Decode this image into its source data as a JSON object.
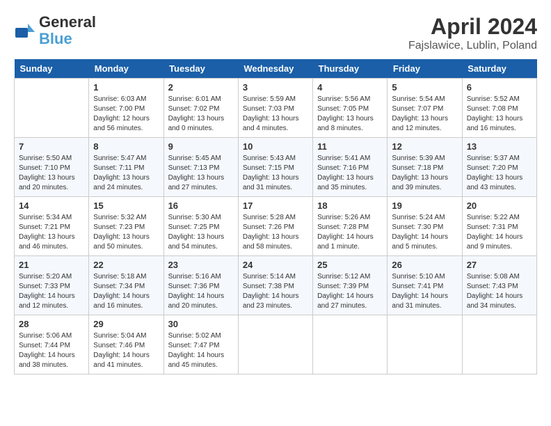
{
  "header": {
    "logo_line1": "General",
    "logo_line2": "Blue",
    "title": "April 2024",
    "location": "Fajslawice, Lublin, Poland"
  },
  "weekdays": [
    "Sunday",
    "Monday",
    "Tuesday",
    "Wednesday",
    "Thursday",
    "Friday",
    "Saturday"
  ],
  "weeks": [
    [
      {
        "day": "",
        "sunrise": "",
        "sunset": "",
        "daylight": ""
      },
      {
        "day": "1",
        "sunrise": "Sunrise: 6:03 AM",
        "sunset": "Sunset: 7:00 PM",
        "daylight": "Daylight: 12 hours and 56 minutes."
      },
      {
        "day": "2",
        "sunrise": "Sunrise: 6:01 AM",
        "sunset": "Sunset: 7:02 PM",
        "daylight": "Daylight: 13 hours and 0 minutes."
      },
      {
        "day": "3",
        "sunrise": "Sunrise: 5:59 AM",
        "sunset": "Sunset: 7:03 PM",
        "daylight": "Daylight: 13 hours and 4 minutes."
      },
      {
        "day": "4",
        "sunrise": "Sunrise: 5:56 AM",
        "sunset": "Sunset: 7:05 PM",
        "daylight": "Daylight: 13 hours and 8 minutes."
      },
      {
        "day": "5",
        "sunrise": "Sunrise: 5:54 AM",
        "sunset": "Sunset: 7:07 PM",
        "daylight": "Daylight: 13 hours and 12 minutes."
      },
      {
        "day": "6",
        "sunrise": "Sunrise: 5:52 AM",
        "sunset": "Sunset: 7:08 PM",
        "daylight": "Daylight: 13 hours and 16 minutes."
      }
    ],
    [
      {
        "day": "7",
        "sunrise": "Sunrise: 5:50 AM",
        "sunset": "Sunset: 7:10 PM",
        "daylight": "Daylight: 13 hours and 20 minutes."
      },
      {
        "day": "8",
        "sunrise": "Sunrise: 5:47 AM",
        "sunset": "Sunset: 7:11 PM",
        "daylight": "Daylight: 13 hours and 24 minutes."
      },
      {
        "day": "9",
        "sunrise": "Sunrise: 5:45 AM",
        "sunset": "Sunset: 7:13 PM",
        "daylight": "Daylight: 13 hours and 27 minutes."
      },
      {
        "day": "10",
        "sunrise": "Sunrise: 5:43 AM",
        "sunset": "Sunset: 7:15 PM",
        "daylight": "Daylight: 13 hours and 31 minutes."
      },
      {
        "day": "11",
        "sunrise": "Sunrise: 5:41 AM",
        "sunset": "Sunset: 7:16 PM",
        "daylight": "Daylight: 13 hours and 35 minutes."
      },
      {
        "day": "12",
        "sunrise": "Sunrise: 5:39 AM",
        "sunset": "Sunset: 7:18 PM",
        "daylight": "Daylight: 13 hours and 39 minutes."
      },
      {
        "day": "13",
        "sunrise": "Sunrise: 5:37 AM",
        "sunset": "Sunset: 7:20 PM",
        "daylight": "Daylight: 13 hours and 43 minutes."
      }
    ],
    [
      {
        "day": "14",
        "sunrise": "Sunrise: 5:34 AM",
        "sunset": "Sunset: 7:21 PM",
        "daylight": "Daylight: 13 hours and 46 minutes."
      },
      {
        "day": "15",
        "sunrise": "Sunrise: 5:32 AM",
        "sunset": "Sunset: 7:23 PM",
        "daylight": "Daylight: 13 hours and 50 minutes."
      },
      {
        "day": "16",
        "sunrise": "Sunrise: 5:30 AM",
        "sunset": "Sunset: 7:25 PM",
        "daylight": "Daylight: 13 hours and 54 minutes."
      },
      {
        "day": "17",
        "sunrise": "Sunrise: 5:28 AM",
        "sunset": "Sunset: 7:26 PM",
        "daylight": "Daylight: 13 hours and 58 minutes."
      },
      {
        "day": "18",
        "sunrise": "Sunrise: 5:26 AM",
        "sunset": "Sunset: 7:28 PM",
        "daylight": "Daylight: 14 hours and 1 minute."
      },
      {
        "day": "19",
        "sunrise": "Sunrise: 5:24 AM",
        "sunset": "Sunset: 7:30 PM",
        "daylight": "Daylight: 14 hours and 5 minutes."
      },
      {
        "day": "20",
        "sunrise": "Sunrise: 5:22 AM",
        "sunset": "Sunset: 7:31 PM",
        "daylight": "Daylight: 14 hours and 9 minutes."
      }
    ],
    [
      {
        "day": "21",
        "sunrise": "Sunrise: 5:20 AM",
        "sunset": "Sunset: 7:33 PM",
        "daylight": "Daylight: 14 hours and 12 minutes."
      },
      {
        "day": "22",
        "sunrise": "Sunrise: 5:18 AM",
        "sunset": "Sunset: 7:34 PM",
        "daylight": "Daylight: 14 hours and 16 minutes."
      },
      {
        "day": "23",
        "sunrise": "Sunrise: 5:16 AM",
        "sunset": "Sunset: 7:36 PM",
        "daylight": "Daylight: 14 hours and 20 minutes."
      },
      {
        "day": "24",
        "sunrise": "Sunrise: 5:14 AM",
        "sunset": "Sunset: 7:38 PM",
        "daylight": "Daylight: 14 hours and 23 minutes."
      },
      {
        "day": "25",
        "sunrise": "Sunrise: 5:12 AM",
        "sunset": "Sunset: 7:39 PM",
        "daylight": "Daylight: 14 hours and 27 minutes."
      },
      {
        "day": "26",
        "sunrise": "Sunrise: 5:10 AM",
        "sunset": "Sunset: 7:41 PM",
        "daylight": "Daylight: 14 hours and 31 minutes."
      },
      {
        "day": "27",
        "sunrise": "Sunrise: 5:08 AM",
        "sunset": "Sunset: 7:43 PM",
        "daylight": "Daylight: 14 hours and 34 minutes."
      }
    ],
    [
      {
        "day": "28",
        "sunrise": "Sunrise: 5:06 AM",
        "sunset": "Sunset: 7:44 PM",
        "daylight": "Daylight: 14 hours and 38 minutes."
      },
      {
        "day": "29",
        "sunrise": "Sunrise: 5:04 AM",
        "sunset": "Sunset: 7:46 PM",
        "daylight": "Daylight: 14 hours and 41 minutes."
      },
      {
        "day": "30",
        "sunrise": "Sunrise: 5:02 AM",
        "sunset": "Sunset: 7:47 PM",
        "daylight": "Daylight: 14 hours and 45 minutes."
      },
      {
        "day": "",
        "sunrise": "",
        "sunset": "",
        "daylight": ""
      },
      {
        "day": "",
        "sunrise": "",
        "sunset": "",
        "daylight": ""
      },
      {
        "day": "",
        "sunrise": "",
        "sunset": "",
        "daylight": ""
      },
      {
        "day": "",
        "sunrise": "",
        "sunset": "",
        "daylight": ""
      }
    ]
  ]
}
